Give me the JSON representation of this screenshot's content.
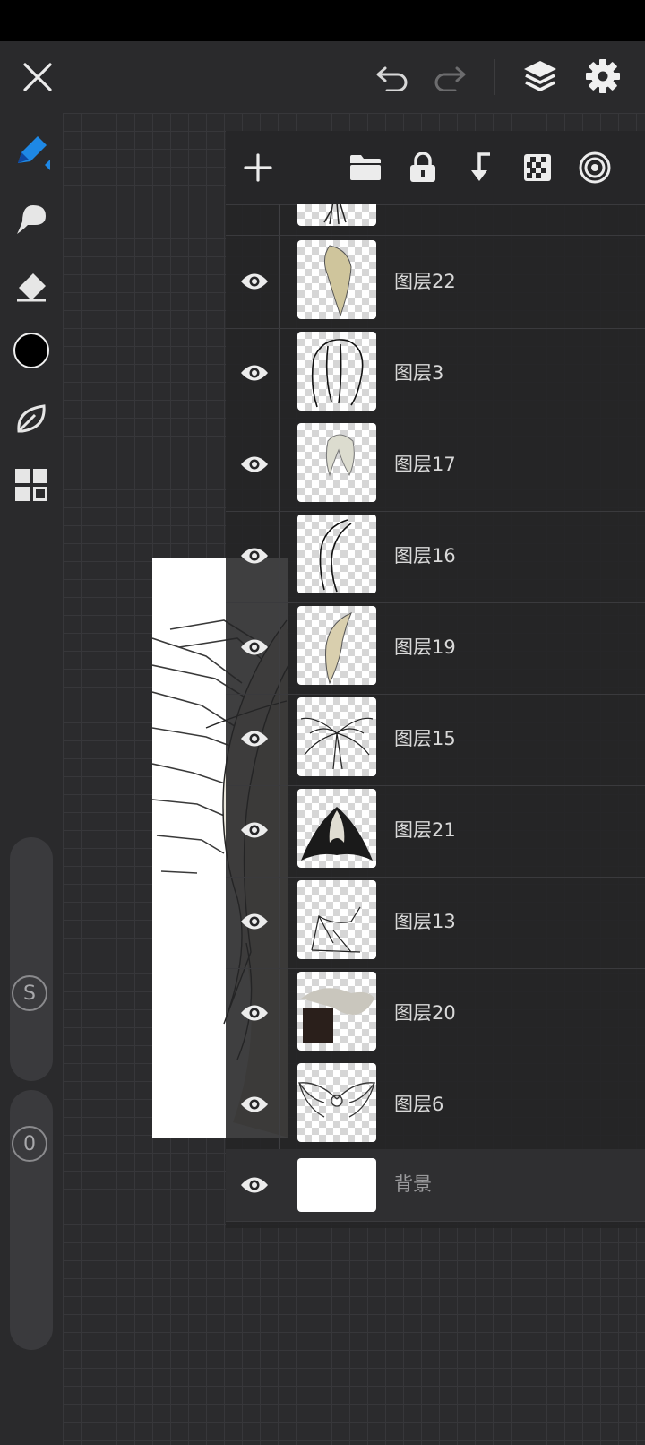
{
  "layers": [
    {
      "name": "图层22"
    },
    {
      "name": "图层3"
    },
    {
      "name": "图层17"
    },
    {
      "name": "图层16"
    },
    {
      "name": "图层19"
    },
    {
      "name": "图层15"
    },
    {
      "name": "图层21"
    },
    {
      "name": "图层13"
    },
    {
      "name": "图层20"
    },
    {
      "name": "图层6"
    }
  ],
  "background_layer": {
    "name": "背景"
  },
  "sidebar": {
    "size_slider_label": "S",
    "opacity_slider_label": "0"
  },
  "colors": {
    "accent": "#1e88e5",
    "current_color": "#000000"
  },
  "icons": {
    "close": "close-icon",
    "undo": "undo-icon",
    "redo": "redo-icon",
    "layers": "layers-icon",
    "settings": "gear-icon",
    "add": "plus-icon",
    "folder": "folder-icon",
    "lock": "lock-icon",
    "merge": "merge-down-icon",
    "transparency": "checkerboard-icon",
    "blend": "target-icon"
  }
}
